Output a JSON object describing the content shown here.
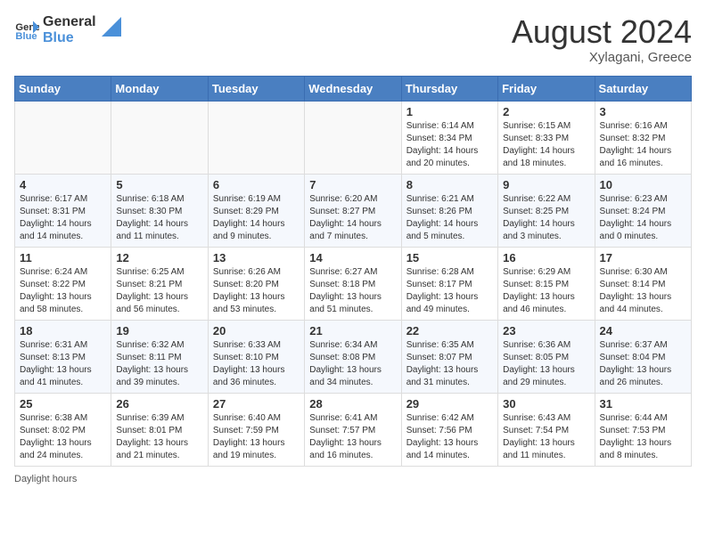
{
  "header": {
    "logo_general": "General",
    "logo_blue": "Blue",
    "month_year": "August 2024",
    "location": "Xylagani, Greece"
  },
  "footer": {
    "daylight_label": "Daylight hours"
  },
  "days_of_week": [
    "Sunday",
    "Monday",
    "Tuesday",
    "Wednesday",
    "Thursday",
    "Friday",
    "Saturday"
  ],
  "weeks": [
    [
      {
        "day": "",
        "info": ""
      },
      {
        "day": "",
        "info": ""
      },
      {
        "day": "",
        "info": ""
      },
      {
        "day": "",
        "info": ""
      },
      {
        "day": "1",
        "info": "Sunrise: 6:14 AM\nSunset: 8:34 PM\nDaylight: 14 hours and 20 minutes."
      },
      {
        "day": "2",
        "info": "Sunrise: 6:15 AM\nSunset: 8:33 PM\nDaylight: 14 hours and 18 minutes."
      },
      {
        "day": "3",
        "info": "Sunrise: 6:16 AM\nSunset: 8:32 PM\nDaylight: 14 hours and 16 minutes."
      }
    ],
    [
      {
        "day": "4",
        "info": "Sunrise: 6:17 AM\nSunset: 8:31 PM\nDaylight: 14 hours and 14 minutes."
      },
      {
        "day": "5",
        "info": "Sunrise: 6:18 AM\nSunset: 8:30 PM\nDaylight: 14 hours and 11 minutes."
      },
      {
        "day": "6",
        "info": "Sunrise: 6:19 AM\nSunset: 8:29 PM\nDaylight: 14 hours and 9 minutes."
      },
      {
        "day": "7",
        "info": "Sunrise: 6:20 AM\nSunset: 8:27 PM\nDaylight: 14 hours and 7 minutes."
      },
      {
        "day": "8",
        "info": "Sunrise: 6:21 AM\nSunset: 8:26 PM\nDaylight: 14 hours and 5 minutes."
      },
      {
        "day": "9",
        "info": "Sunrise: 6:22 AM\nSunset: 8:25 PM\nDaylight: 14 hours and 3 minutes."
      },
      {
        "day": "10",
        "info": "Sunrise: 6:23 AM\nSunset: 8:24 PM\nDaylight: 14 hours and 0 minutes."
      }
    ],
    [
      {
        "day": "11",
        "info": "Sunrise: 6:24 AM\nSunset: 8:22 PM\nDaylight: 13 hours and 58 minutes."
      },
      {
        "day": "12",
        "info": "Sunrise: 6:25 AM\nSunset: 8:21 PM\nDaylight: 13 hours and 56 minutes."
      },
      {
        "day": "13",
        "info": "Sunrise: 6:26 AM\nSunset: 8:20 PM\nDaylight: 13 hours and 53 minutes."
      },
      {
        "day": "14",
        "info": "Sunrise: 6:27 AM\nSunset: 8:18 PM\nDaylight: 13 hours and 51 minutes."
      },
      {
        "day": "15",
        "info": "Sunrise: 6:28 AM\nSunset: 8:17 PM\nDaylight: 13 hours and 49 minutes."
      },
      {
        "day": "16",
        "info": "Sunrise: 6:29 AM\nSunset: 8:15 PM\nDaylight: 13 hours and 46 minutes."
      },
      {
        "day": "17",
        "info": "Sunrise: 6:30 AM\nSunset: 8:14 PM\nDaylight: 13 hours and 44 minutes."
      }
    ],
    [
      {
        "day": "18",
        "info": "Sunrise: 6:31 AM\nSunset: 8:13 PM\nDaylight: 13 hours and 41 minutes."
      },
      {
        "day": "19",
        "info": "Sunrise: 6:32 AM\nSunset: 8:11 PM\nDaylight: 13 hours and 39 minutes."
      },
      {
        "day": "20",
        "info": "Sunrise: 6:33 AM\nSunset: 8:10 PM\nDaylight: 13 hours and 36 minutes."
      },
      {
        "day": "21",
        "info": "Sunrise: 6:34 AM\nSunset: 8:08 PM\nDaylight: 13 hours and 34 minutes."
      },
      {
        "day": "22",
        "info": "Sunrise: 6:35 AM\nSunset: 8:07 PM\nDaylight: 13 hours and 31 minutes."
      },
      {
        "day": "23",
        "info": "Sunrise: 6:36 AM\nSunset: 8:05 PM\nDaylight: 13 hours and 29 minutes."
      },
      {
        "day": "24",
        "info": "Sunrise: 6:37 AM\nSunset: 8:04 PM\nDaylight: 13 hours and 26 minutes."
      }
    ],
    [
      {
        "day": "25",
        "info": "Sunrise: 6:38 AM\nSunset: 8:02 PM\nDaylight: 13 hours and 24 minutes."
      },
      {
        "day": "26",
        "info": "Sunrise: 6:39 AM\nSunset: 8:01 PM\nDaylight: 13 hours and 21 minutes."
      },
      {
        "day": "27",
        "info": "Sunrise: 6:40 AM\nSunset: 7:59 PM\nDaylight: 13 hours and 19 minutes."
      },
      {
        "day": "28",
        "info": "Sunrise: 6:41 AM\nSunset: 7:57 PM\nDaylight: 13 hours and 16 minutes."
      },
      {
        "day": "29",
        "info": "Sunrise: 6:42 AM\nSunset: 7:56 PM\nDaylight: 13 hours and 14 minutes."
      },
      {
        "day": "30",
        "info": "Sunrise: 6:43 AM\nSunset: 7:54 PM\nDaylight: 13 hours and 11 minutes."
      },
      {
        "day": "31",
        "info": "Sunrise: 6:44 AM\nSunset: 7:53 PM\nDaylight: 13 hours and 8 minutes."
      }
    ]
  ]
}
